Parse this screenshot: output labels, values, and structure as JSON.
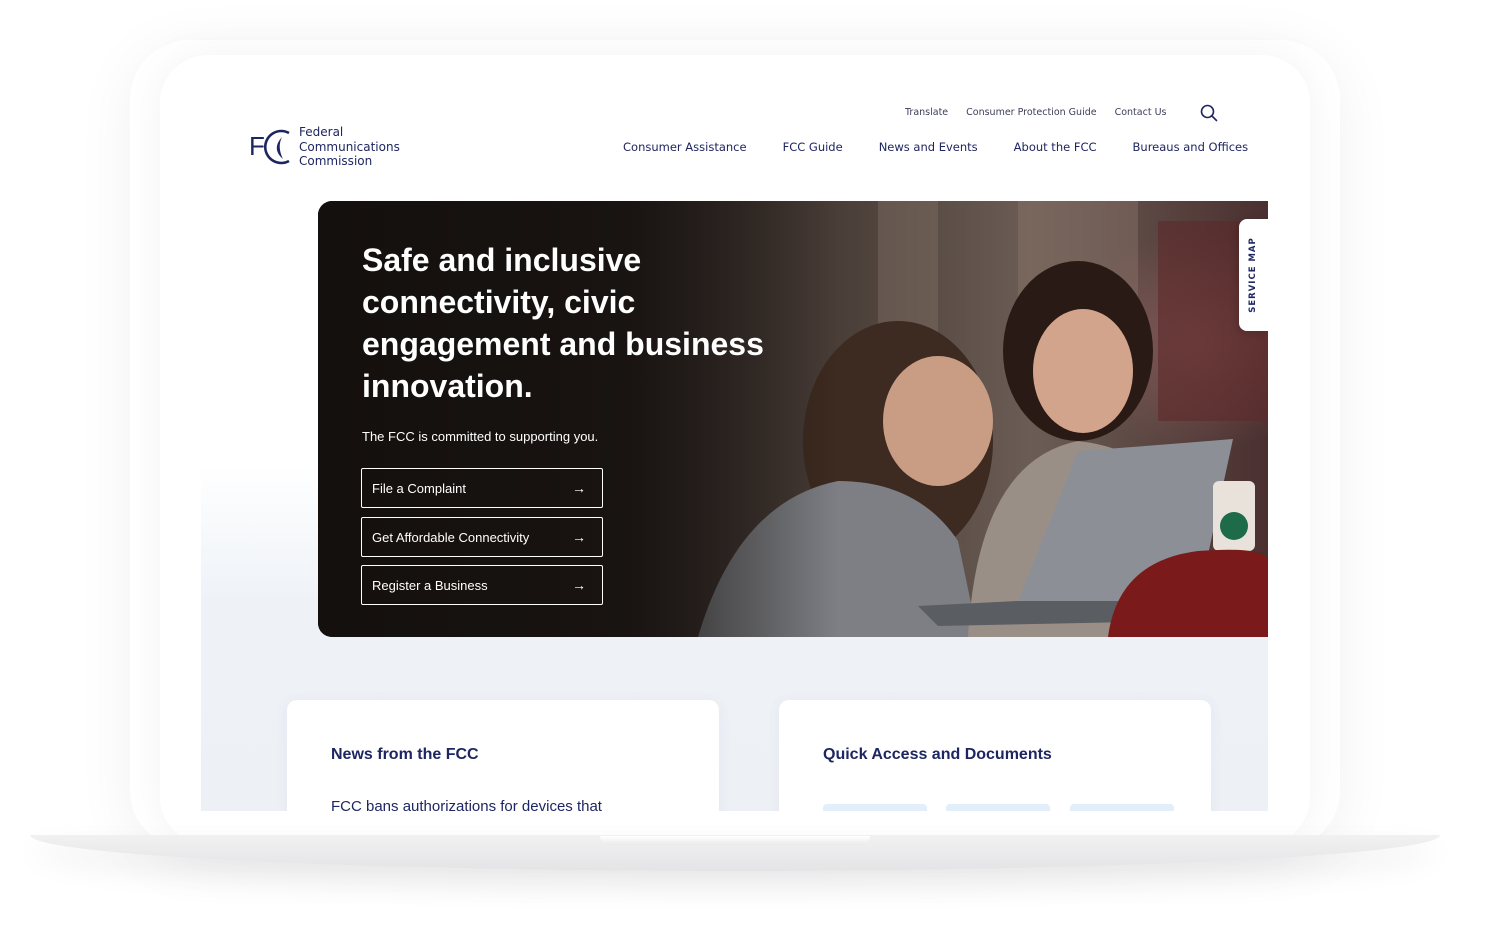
{
  "header": {
    "logo_text_line1": "Federal",
    "logo_text_line2": "Communications",
    "logo_text_line3": "Commission",
    "utility_nav": [
      "Translate",
      "Consumer Protection Guide",
      "Contact Us"
    ],
    "main_nav": [
      "Consumer Assistance",
      "FCC Guide",
      "News and Events",
      "About the FCC",
      "Bureaus and Offices"
    ]
  },
  "hero": {
    "title": "Safe and inclusive connectivity, civic engagement and business innovation.",
    "subtitle": "The FCC is committed to supporting you.",
    "buttons": [
      "File a Complaint",
      "Get Affordable Connectivity",
      "Register a Business"
    ]
  },
  "service_map": {
    "label": "SERVICE MAP"
  },
  "cards": {
    "news_title": "News from the FCC",
    "news_first_item": "FCC bans authorizations for devices that",
    "quick_access_title": "Quick Access and Documents"
  },
  "colors": {
    "brand_navy": "#1e2661",
    "tile_blue": "#e2eef9"
  },
  "icons": {
    "search": "search-icon",
    "arrow": "arrow-right-icon"
  }
}
